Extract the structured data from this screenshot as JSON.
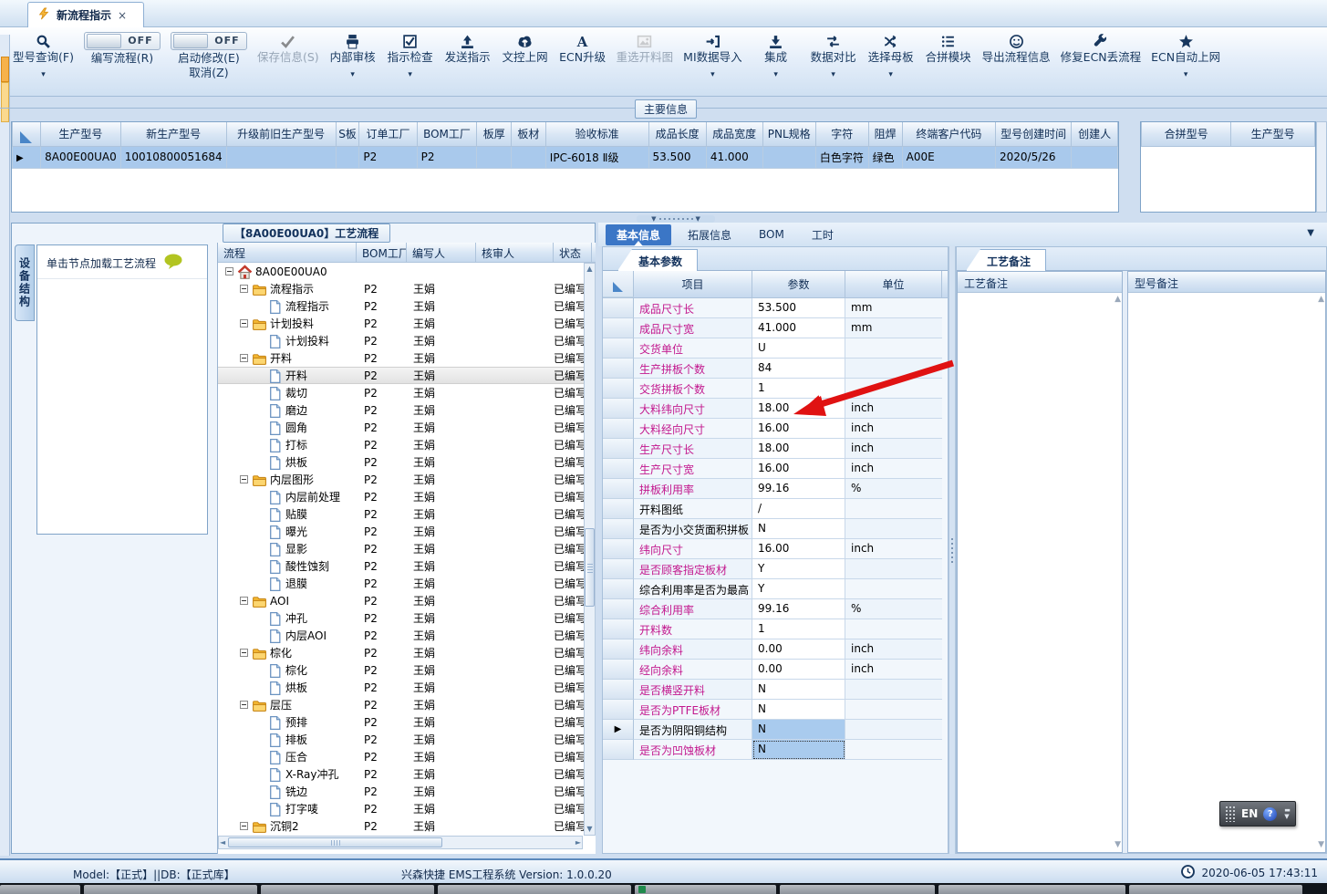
{
  "window": {
    "tab_title": "新流程指示",
    "close_glyph": "×"
  },
  "toolbar": {
    "items": [
      {
        "label": "型号查询(F)",
        "icon": "search",
        "dropdown": true
      },
      {
        "label": "编写流程(R)",
        "icon": "toggle",
        "toggle": "OFF"
      },
      {
        "label": "启动修改(E)",
        "label2": "取消(Z)",
        "icon": "toggle",
        "toggle": "OFF"
      },
      {
        "label": "保存信息(S)",
        "icon": "check",
        "disabled": true
      },
      {
        "label": "内部审核",
        "icon": "printer",
        "dropdown": true
      },
      {
        "label": "指示检查",
        "icon": "checkbox",
        "dropdown": true
      },
      {
        "label": "发送指示",
        "icon": "upload"
      },
      {
        "label": "文控上网",
        "icon": "cloud-upload"
      },
      {
        "label": "ECN升级",
        "icon": "letter-a"
      },
      {
        "label": "重选开料图",
        "icon": "image",
        "disabled": true
      },
      {
        "label": "MI数据导入",
        "icon": "import",
        "dropdown": true
      },
      {
        "label": "集成",
        "icon": "download",
        "dropdown": true
      },
      {
        "label": "数据对比",
        "icon": "compare",
        "dropdown": true
      },
      {
        "label": "选择母板",
        "icon": "shuffle",
        "dropdown": true
      },
      {
        "label": "合拼模块",
        "icon": "list"
      },
      {
        "label": "导出流程信息",
        "icon": "smiley"
      },
      {
        "label": "修复ECN丢流程",
        "icon": "wrench"
      },
      {
        "label": "ECN自动上网",
        "icon": "star",
        "dropdown": true
      }
    ]
  },
  "main_info": {
    "group_label": "主要信息",
    "columns": [
      "生产型号",
      "新生产型号",
      "升级前旧生产型号",
      "S板",
      "订单工厂",
      "BOM工厂",
      "板厚",
      "板材",
      "验收标准",
      "成品长度",
      "成品宽度",
      "PNL规格",
      "字符",
      "阻焊",
      "终端客户代码",
      "型号创建时间",
      "创建人"
    ],
    "row": [
      "8A00E00UA0",
      "10010800051684",
      "",
      "",
      "P2",
      "P2",
      "",
      "",
      "IPC-6018 Ⅱ级",
      "53.500",
      "41.000",
      "",
      "白色字符",
      "绿色",
      "A00E",
      "2020/5/26",
      ""
    ],
    "merge_columns": [
      "合拼型号",
      "生产型号"
    ]
  },
  "left_panel": {
    "side_tab": "设备结构",
    "hint": "单击节点加载工艺流程"
  },
  "tree": {
    "title": "【8A00E00UA0】工艺流程",
    "columns": [
      "流程",
      "BOM工厂",
      "编写人",
      "核审人",
      "状态"
    ],
    "rows": [
      {
        "label": "8A00E00UA0",
        "type": "home",
        "level": 0,
        "bom": "",
        "writer": "",
        "reviewer": "",
        "status": ""
      },
      {
        "label": "流程指示",
        "type": "folder",
        "level": 1,
        "bom": "P2",
        "writer": "王娟",
        "reviewer": "",
        "status": "已编写"
      },
      {
        "label": "流程指示",
        "type": "file",
        "level": 2,
        "bom": "P2",
        "writer": "王娟",
        "reviewer": "",
        "status": "已编写"
      },
      {
        "label": "计划投料",
        "type": "folder",
        "level": 1,
        "bom": "P2",
        "writer": "王娟",
        "reviewer": "",
        "status": "已编写"
      },
      {
        "label": "计划投料",
        "type": "file",
        "level": 2,
        "bom": "P2",
        "writer": "王娟",
        "reviewer": "",
        "status": "已编写"
      },
      {
        "label": "开料",
        "type": "folder",
        "level": 1,
        "bom": "P2",
        "writer": "王娟",
        "reviewer": "",
        "status": "已编写"
      },
      {
        "label": "开料",
        "type": "file",
        "level": 2,
        "bom": "P2",
        "writer": "王娟",
        "reviewer": "",
        "status": "已编写",
        "selected": true
      },
      {
        "label": "裁切",
        "type": "file",
        "level": 2,
        "bom": "P2",
        "writer": "王娟",
        "reviewer": "",
        "status": "已编写"
      },
      {
        "label": "磨边",
        "type": "file",
        "level": 2,
        "bom": "P2",
        "writer": "王娟",
        "reviewer": "",
        "status": "已编写"
      },
      {
        "label": "圆角",
        "type": "file",
        "level": 2,
        "bom": "P2",
        "writer": "王娟",
        "reviewer": "",
        "status": "已编写"
      },
      {
        "label": "打标",
        "type": "file",
        "level": 2,
        "bom": "P2",
        "writer": "王娟",
        "reviewer": "",
        "status": "已编写"
      },
      {
        "label": "烘板",
        "type": "file",
        "level": 2,
        "bom": "P2",
        "writer": "王娟",
        "reviewer": "",
        "status": "已编写"
      },
      {
        "label": "内层图形",
        "type": "folder",
        "level": 1,
        "bom": "P2",
        "writer": "王娟",
        "reviewer": "",
        "status": "已编写"
      },
      {
        "label": "内层前处理",
        "type": "file",
        "level": 2,
        "bom": "P2",
        "writer": "王娟",
        "reviewer": "",
        "status": "已编写"
      },
      {
        "label": "贴膜",
        "type": "file",
        "level": 2,
        "bom": "P2",
        "writer": "王娟",
        "reviewer": "",
        "status": "已编写"
      },
      {
        "label": "曝光",
        "type": "file",
        "level": 2,
        "bom": "P2",
        "writer": "王娟",
        "reviewer": "",
        "status": "已编写"
      },
      {
        "label": "显影",
        "type": "file",
        "level": 2,
        "bom": "P2",
        "writer": "王娟",
        "reviewer": "",
        "status": "已编写"
      },
      {
        "label": "酸性蚀刻",
        "type": "file",
        "level": 2,
        "bom": "P2",
        "writer": "王娟",
        "reviewer": "",
        "status": "已编写"
      },
      {
        "label": "退膜",
        "type": "file",
        "level": 2,
        "bom": "P2",
        "writer": "王娟",
        "reviewer": "",
        "status": "已编写"
      },
      {
        "label": "AOI",
        "type": "folder",
        "level": 1,
        "bom": "P2",
        "writer": "王娟",
        "reviewer": "",
        "status": "已编写"
      },
      {
        "label": "冲孔",
        "type": "file",
        "level": 2,
        "bom": "P2",
        "writer": "王娟",
        "reviewer": "",
        "status": "已编写"
      },
      {
        "label": "内层AOI",
        "type": "file",
        "level": 2,
        "bom": "P2",
        "writer": "王娟",
        "reviewer": "",
        "status": "已编写"
      },
      {
        "label": "棕化",
        "type": "folder",
        "level": 1,
        "bom": "P2",
        "writer": "王娟",
        "reviewer": "",
        "status": "已编写"
      },
      {
        "label": "棕化",
        "type": "file",
        "level": 2,
        "bom": "P2",
        "writer": "王娟",
        "reviewer": "",
        "status": "已编写"
      },
      {
        "label": "烘板",
        "type": "file",
        "level": 2,
        "bom": "P2",
        "writer": "王娟",
        "reviewer": "",
        "status": "已编写"
      },
      {
        "label": "层压",
        "type": "folder",
        "level": 1,
        "bom": "P2",
        "writer": "王娟",
        "reviewer": "",
        "status": "已编写"
      },
      {
        "label": "预排",
        "type": "file",
        "level": 2,
        "bom": "P2",
        "writer": "王娟",
        "reviewer": "",
        "status": "已编写"
      },
      {
        "label": "排板",
        "type": "file",
        "level": 2,
        "bom": "P2",
        "writer": "王娟",
        "reviewer": "",
        "status": "已编写"
      },
      {
        "label": "压合",
        "type": "file",
        "level": 2,
        "bom": "P2",
        "writer": "王娟",
        "reviewer": "",
        "status": "已编写"
      },
      {
        "label": "X-Ray冲孔",
        "type": "file",
        "level": 2,
        "bom": "P2",
        "writer": "王娟",
        "reviewer": "",
        "status": "已编写"
      },
      {
        "label": "铣边",
        "type": "file",
        "level": 2,
        "bom": "P2",
        "writer": "王娟",
        "reviewer": "",
        "status": "已编写"
      },
      {
        "label": "打字唛",
        "type": "file",
        "level": 2,
        "bom": "P2",
        "writer": "王娟",
        "reviewer": "",
        "status": "已编写"
      },
      {
        "label": "沉铜2",
        "type": "folder",
        "level": 1,
        "bom": "P2",
        "writer": "王娟",
        "reviewer": "",
        "status": "已编写"
      }
    ]
  },
  "detail": {
    "tabs": [
      "基本信息",
      "拓展信息",
      "BOM",
      "工时"
    ],
    "active_tab": "基本信息",
    "sub_tab": "基本参数",
    "param_columns": [
      "项目",
      "参数",
      "单位"
    ],
    "params": [
      {
        "item": "成品尺寸长",
        "value": "53.500",
        "unit": "mm",
        "link": true
      },
      {
        "item": "成品尺寸宽",
        "value": "41.000",
        "unit": "mm",
        "link": true
      },
      {
        "item": "交货单位",
        "value": "U",
        "unit": "",
        "link": true
      },
      {
        "item": "生产拼板个数",
        "value": "84",
        "unit": "",
        "link": true
      },
      {
        "item": "交货拼板个数",
        "value": "1",
        "unit": "",
        "link": true
      },
      {
        "item": "大料纬向尺寸",
        "value": "18.00",
        "unit": "inch",
        "link": true
      },
      {
        "item": "大料经向尺寸",
        "value": "16.00",
        "unit": "inch",
        "link": true
      },
      {
        "item": "生产尺寸长",
        "value": "18.00",
        "unit": "inch",
        "link": true
      },
      {
        "item": "生产尺寸宽",
        "value": "16.00",
        "unit": "inch",
        "link": true
      },
      {
        "item": "拼板利用率",
        "value": "99.16",
        "unit": "%",
        "link": true
      },
      {
        "item": "开料图纸",
        "value": "/",
        "unit": "",
        "link": false
      },
      {
        "item": "是否为小交货面积拼板",
        "value": "N",
        "unit": "",
        "link": false
      },
      {
        "item": "纬向尺寸",
        "value": "16.00",
        "unit": "inch",
        "link": true
      },
      {
        "item": "是否顾客指定板材",
        "value": "Y",
        "unit": "",
        "link": true
      },
      {
        "item": "综合利用率是否为最高",
        "value": "Y",
        "unit": "",
        "link": false
      },
      {
        "item": "综合利用率",
        "value": "99.16",
        "unit": "%",
        "link": true
      },
      {
        "item": "开料数",
        "value": "1",
        "unit": "",
        "link": true
      },
      {
        "item": "纬向余料",
        "value": "0.00",
        "unit": "inch",
        "link": true
      },
      {
        "item": "经向余料",
        "value": "0.00",
        "unit": "inch",
        "link": true
      },
      {
        "item": "是否横竖开料",
        "value": "N",
        "unit": "",
        "link": true
      },
      {
        "item": "是否为PTFE板材",
        "value": "N",
        "unit": "",
        "link": true
      },
      {
        "item": "是否为阴阳铜结构",
        "value": "N",
        "unit": "",
        "link": false,
        "selected": true
      },
      {
        "item": "是否为凹蚀板材",
        "value": "N",
        "unit": "",
        "link": true,
        "focused": true
      }
    ]
  },
  "remarks": {
    "tab": "工艺备注",
    "columns": [
      "工艺备注",
      "型号备注"
    ]
  },
  "status_bar": {
    "left": "Model:【正式】||DB:【正式库】",
    "center": "兴森快捷 EMS工程系统 Version: 1.0.0.20",
    "time": "2020-06-05 17:43:11"
  },
  "lang_bar": {
    "label": "EN",
    "help": "?"
  },
  "colors": {
    "accent": "#3b76c6",
    "link": "#c2188e",
    "selection": "#a9cbee",
    "arrow": "#e01212"
  }
}
